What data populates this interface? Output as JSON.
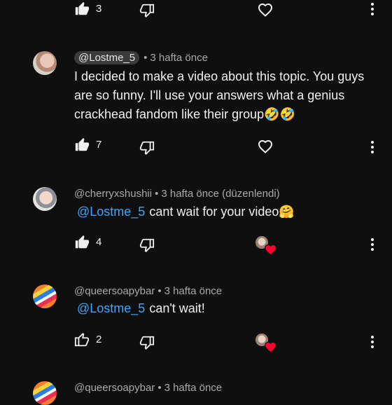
{
  "top_row": {
    "likes": "3"
  },
  "comments": [
    {
      "username": "@Lostme_5",
      "time": "3 hafta önce",
      "text": "I decided to make a video about this topic. You guys are so funny. I'll use your answers what a genius crackhead  fandom like their group🤣🤣",
      "likes": "7",
      "creator_heart": false
    },
    {
      "username": "@cherryxshushii",
      "time": "3 hafta önce (düzenlendi)",
      "mention": "@Lostme_5",
      "text": "cant wait for your video🤗",
      "likes": "4",
      "creator_heart": true
    },
    {
      "username": "@queersoapybar",
      "time": "3 hafta önce",
      "mention": "@Lostme_5",
      "text": "can't wait!",
      "likes": "2",
      "creator_heart": true
    },
    {
      "username": "@queersoapybar",
      "time": "3 hafta önce"
    }
  ],
  "colors": {
    "background": "#0f0f0f",
    "mention": "#3ea6ff",
    "heart": "#ff0033",
    "meta": "#aaaaaa"
  }
}
